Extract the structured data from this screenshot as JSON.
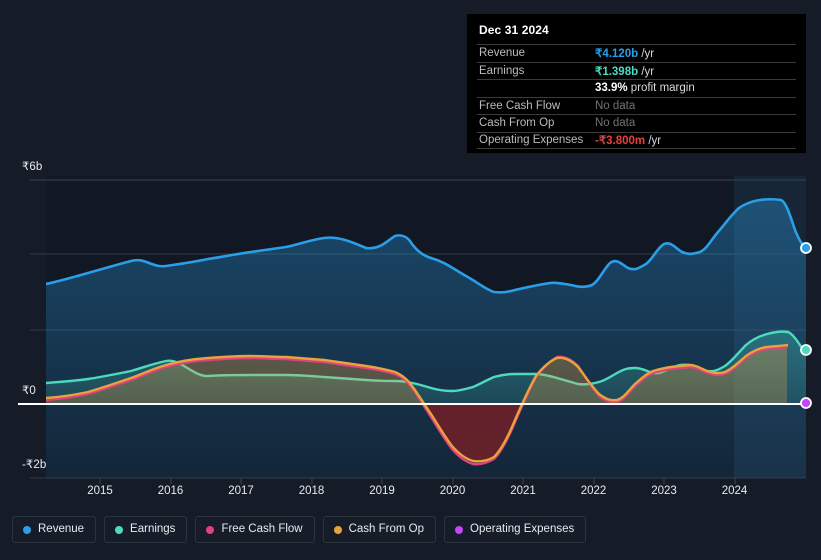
{
  "tooltip": {
    "title": "Dec 31 2024",
    "rows": [
      {
        "key": "Revenue",
        "amount": "₹4.120b",
        "unit": " /yr",
        "style": "revenue"
      },
      {
        "key": "Earnings",
        "amount": "₹1.398b",
        "unit": " /yr",
        "style": "earnings"
      },
      {
        "key": "",
        "amount": "33.9%",
        "unit": " profit margin",
        "style": "margin"
      },
      {
        "key": "Free Cash Flow",
        "amount": "",
        "unit": "No data",
        "style": "nodata"
      },
      {
        "key": "Cash From Op",
        "amount": "",
        "unit": "No data",
        "style": "nodata"
      },
      {
        "key": "Operating Expenses",
        "amount": "-₹3.800m",
        "unit": " /yr",
        "style": "opex"
      }
    ]
  },
  "legend": {
    "items": [
      {
        "label": "Revenue",
        "color": "#2a9fe8"
      },
      {
        "label": "Earnings",
        "color": "#4ddbc0"
      },
      {
        "label": "Free Cash Flow",
        "color": "#e0417f"
      },
      {
        "label": "Cash From Op",
        "color": "#e8a33d"
      },
      {
        "label": "Operating Expenses",
        "color": "#c644fc"
      }
    ]
  },
  "axes": {
    "y_labels": [
      {
        "text": "₹6b",
        "value": 6
      },
      {
        "text": "₹0",
        "value": 0
      },
      {
        "text": "-₹2b",
        "value": -2
      }
    ],
    "x_labels": [
      "2015",
      "2016",
      "2017",
      "2018",
      "2019",
      "2020",
      "2021",
      "2022",
      "2023",
      "2024"
    ]
  },
  "chart_data": {
    "type": "area",
    "title": "Dec 31 2024",
    "xlabel": "",
    "ylabel": "₹",
    "currency": "₹",
    "units": "billions",
    "ylim": [
      -2,
      6
    ],
    "yticks": [
      6,
      4,
      2,
      0,
      -2
    ],
    "ytick_labels": [
      "₹6b",
      "",
      "",
      "₹0",
      "-₹2b"
    ],
    "grid": true,
    "legend_position": "bottom",
    "x_axis_years": [
      "2015",
      "2016",
      "2017",
      "2018",
      "2019",
      "2020",
      "2021",
      "2022",
      "2023",
      "2024"
    ],
    "forecast_shading": {
      "from": "2024-05",
      "to": "2025-01",
      "label": "highlighted period"
    },
    "endpoint_date": "Dec 31 2024",
    "endpoints": {
      "Revenue": 4.12,
      "Earnings": 1.398,
      "Free Cash Flow": null,
      "Cash From Op": null,
      "Operating Expenses": -0.0038
    },
    "x": [
      2014.5,
      2014.75,
      2015.0,
      2015.25,
      2015.5,
      2015.75,
      2016.0,
      2016.25,
      2016.5,
      2016.75,
      2017.0,
      2017.25,
      2017.5,
      2017.75,
      2018.0,
      2018.25,
      2018.5,
      2018.75,
      2019.0,
      2019.25,
      2019.5,
      2019.75,
      2020.0,
      2020.25,
      2020.5,
      2020.75,
      2021.0,
      2021.25,
      2021.5,
      2021.75,
      2022.0,
      2022.25,
      2022.5,
      2022.75,
      2023.0,
      2023.25,
      2023.5,
      2023.75,
      2024.0,
      2024.25,
      2024.5,
      2024.75,
      2025.0
    ],
    "series": [
      {
        "name": "Revenue",
        "color": "#2a9fe8",
        "values": [
          3.2,
          3.28,
          3.38,
          3.48,
          3.56,
          3.66,
          3.78,
          3.82,
          3.85,
          3.9,
          3.94,
          3.98,
          4.02,
          4.06,
          4.1,
          4.15,
          4.3,
          4.48,
          4.52,
          4.4,
          4.32,
          4.28,
          4.24,
          4.0,
          3.72,
          3.62,
          3.7,
          3.76,
          3.74,
          3.8,
          3.92,
          4.12,
          4.35,
          4.18,
          4.02,
          4.22,
          4.38,
          4.22,
          4.28,
          4.7,
          5.22,
          5.45,
          4.12
        ]
      },
      {
        "name": "Earnings",
        "color": "#4ddbc0",
        "values": [
          0.28,
          0.3,
          0.33,
          0.38,
          0.44,
          0.52,
          0.6,
          0.66,
          0.72,
          0.76,
          0.8,
          0.82,
          0.84,
          0.84,
          0.84,
          0.83,
          0.82,
          0.8,
          0.78,
          0.74,
          0.66,
          0.58,
          0.52,
          0.5,
          0.54,
          0.58,
          0.66,
          0.78,
          0.8,
          0.74,
          0.68,
          0.7,
          0.82,
          0.9,
          0.86,
          0.88,
          0.94,
          0.88,
          0.86,
          1.04,
          1.32,
          1.52,
          1.398
        ]
      },
      {
        "name": "Cash From Op",
        "color": "#e8a33d",
        "values": [
          0.14,
          0.18,
          0.24,
          0.32,
          0.42,
          0.54,
          0.66,
          0.74,
          0.82,
          0.88,
          0.92,
          0.94,
          0.95,
          0.95,
          0.94,
          0.92,
          0.9,
          0.86,
          0.78,
          0.6,
          0.34,
          0.04,
          -0.26,
          -0.86,
          -1.4,
          -1.56,
          -1.22,
          -0.2,
          0.58,
          0.8,
          0.4,
          0.02,
          0.36,
          0.62,
          0.74,
          0.84,
          0.88,
          0.74,
          0.66,
          0.92,
          1.14,
          1.2,
          null
        ]
      },
      {
        "name": "Free Cash Flow",
        "color": "#e0417f",
        "values": [
          0.12,
          0.16,
          0.22,
          0.3,
          0.4,
          0.52,
          0.64,
          0.72,
          0.8,
          0.86,
          0.9,
          0.92,
          0.93,
          0.93,
          0.92,
          0.9,
          0.88,
          0.84,
          0.76,
          0.58,
          0.32,
          0.02,
          -0.28,
          -0.88,
          -1.43,
          -1.6,
          -1.25,
          -0.22,
          0.6,
          0.82,
          0.38,
          0.0,
          0.34,
          0.6,
          0.72,
          0.82,
          0.86,
          0.72,
          0.64,
          0.9,
          1.12,
          1.18,
          null
        ]
      },
      {
        "name": "Operating Expenses",
        "color": "#c644fc",
        "values": [
          0,
          0,
          0,
          0,
          0,
          0,
          0,
          0,
          0,
          0,
          0,
          0,
          0,
          0,
          0,
          0,
          0,
          0,
          0,
          0,
          0,
          0,
          0,
          0,
          0,
          0,
          0,
          0,
          0,
          0,
          0,
          0,
          0,
          0,
          0,
          0,
          0,
          0,
          0,
          0,
          0,
          0,
          -0.0038
        ]
      }
    ]
  }
}
